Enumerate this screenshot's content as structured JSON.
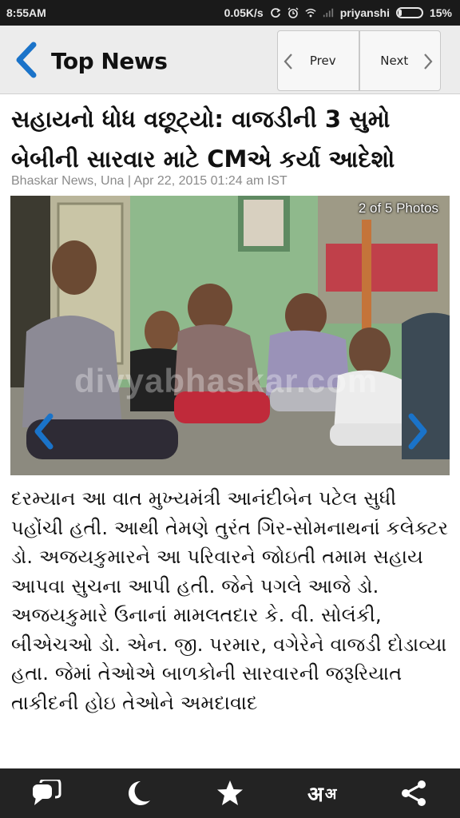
{
  "status_bar": {
    "time": "8:55AM",
    "network_speed": "0.05K/s",
    "carrier": "priyanshi",
    "battery_percent": "15%",
    "battery_level": 0.15,
    "icons": [
      "sync-icon",
      "alarm-icon",
      "wifi-icon",
      "signal-icon",
      "battery-icon"
    ]
  },
  "header": {
    "title": "Top News",
    "prev_label": "Prev",
    "next_label": "Next"
  },
  "article": {
    "headline": "સહાયનો ધોધ વછૂટ્યો: વાજડીની 3 સુમો બેબીની સારવાર માટે CMએ કર્યા આદેશો",
    "byline": "Bhaskar News, Una | Apr 22, 2015 01:24 am IST",
    "photo_counter": "2 of 5 Photos",
    "photo_watermark": "divyabhaskar.com",
    "body": "દરમ્યાન આ વાત મુખ્યમંત્રી આનંદીબેન પટેલ સુધી પહોંચી હતી. આથી તેમણે તુરંત ગિર-સોમનાથનાં કલેક્ટર ડો. અજયકુમારને આ પરિવારને જોઇતી તમામ સહાય આપવા સુચના આપી હતી. જેને પગલે આજે ડો. અજયકુમારે ઉનાનાં મામલતદાર કે. વી. સોલંકી, બીએચઓ ડો. એન. જી. પરમાર, વગેરેને વાજડી દોડાવ્યા હતા. જેમાં તેઓએ બાળકોની સારવારની જરૂરિયાત તાકીદની હોઇ તેઓને અમદાવાદ"
  },
  "toolbar": {
    "lang_big": "अ",
    "lang_small": "अ",
    "icons": [
      "comments-icon",
      "night-mode-icon",
      "bookmark-star-icon",
      "font-size-icon",
      "share-icon"
    ]
  },
  "colors": {
    "accent": "#1a73c9",
    "status_bar_bg": "#1a1a1a",
    "header_bg": "#ececec",
    "toolbar_bg": "#232323",
    "byline": "#8a8a8a"
  }
}
